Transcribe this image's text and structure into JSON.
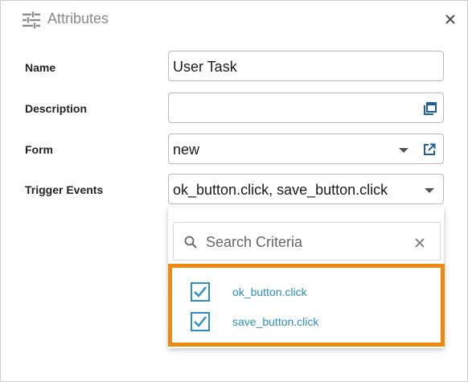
{
  "header": {
    "title": "Attributes",
    "icon": "sliders-icon",
    "close_icon": "close-icon"
  },
  "fields": {
    "name": {
      "label": "Name",
      "value": "User Task"
    },
    "description": {
      "label": "Description",
      "value": "",
      "icon": "expand-window-icon"
    },
    "form": {
      "label": "Form",
      "value": "new",
      "icon": "open-external-icon"
    },
    "trigger_events": {
      "label": "Trigger Events",
      "value": "ok_button.click, save_button.click"
    }
  },
  "dropdown": {
    "search_placeholder": "Search Criteria",
    "options": [
      {
        "label": "ok_button.click",
        "checked": true
      },
      {
        "label": "save_button.click",
        "checked": true
      }
    ]
  },
  "colors": {
    "accent": "#2a8fc1",
    "highlight_border": "#ef8a10",
    "field_border": "#b9b9b9"
  }
}
